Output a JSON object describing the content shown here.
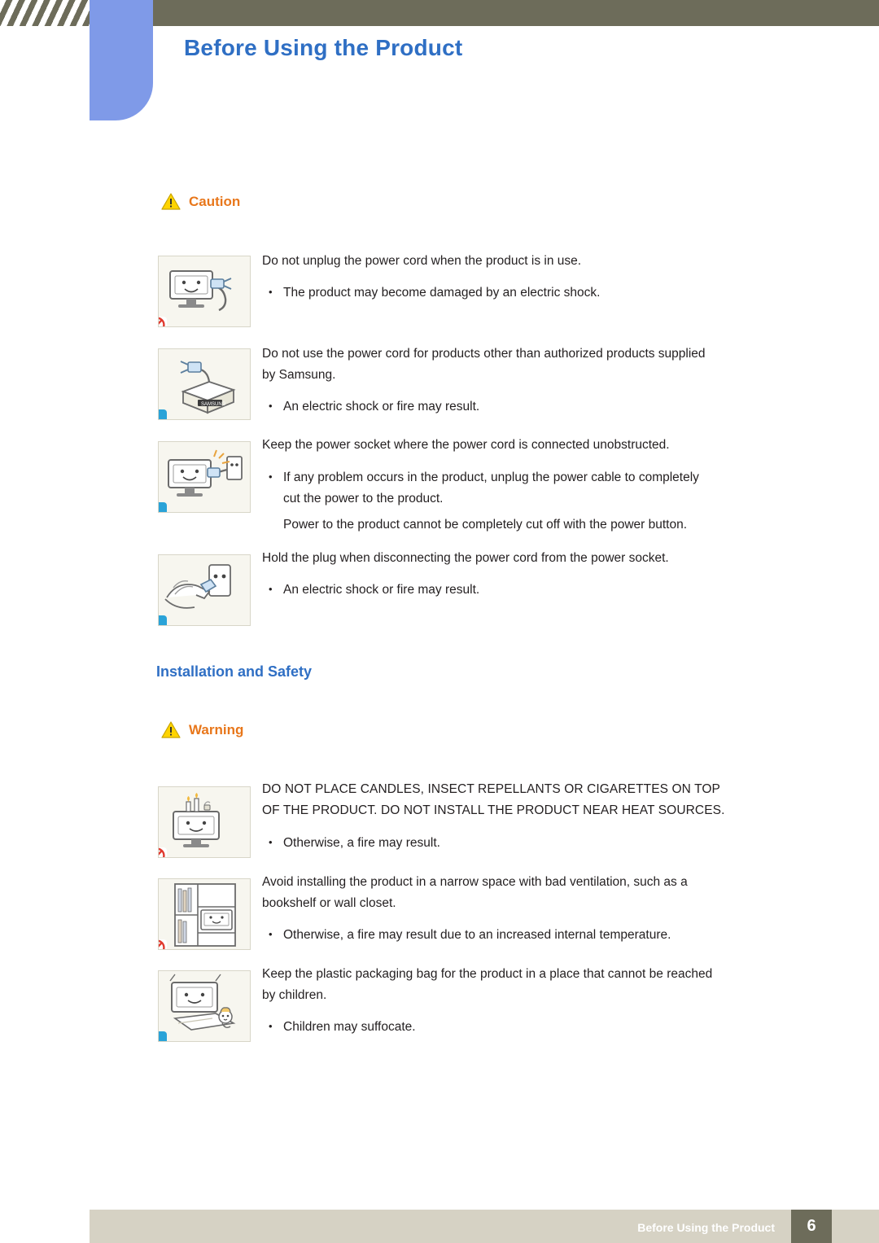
{
  "header": {
    "title": "Before Using the Product"
  },
  "caution": {
    "label": "Caution",
    "icon": "warning-triangle-icon",
    "items": [
      {
        "figure": "monitor-unplug-icon",
        "badge": "forbid",
        "lines": [
          "Do not unplug the power cord when the product is in use."
        ],
        "bullets": [
          "The product may become damaged by an electric shock."
        ]
      },
      {
        "figure": "power-cord-box-icon",
        "badge": "info",
        "lines": [
          "Do not use the power cord for products other than authorized products supplied",
          "by Samsung."
        ],
        "bullets": [
          "An electric shock or fire may result."
        ]
      },
      {
        "figure": "monitor-socket-icon",
        "badge": "info",
        "lines": [
          "Keep the power socket where the power cord is connected unobstructed."
        ],
        "bullets": [
          "If any problem occurs in the product, unplug the power cable to completely",
          "cut the power to the product."
        ],
        "extra": [
          "Power to the product cannot be completely cut off with the power button."
        ]
      },
      {
        "figure": "hand-plug-socket-icon",
        "badge": "info",
        "lines": [
          "Hold the plug when disconnecting the power cord from the power socket."
        ],
        "bullets": [
          "An electric shock or fire may result."
        ]
      }
    ]
  },
  "section": {
    "title": "Installation and Safety"
  },
  "warning": {
    "label": "Warning",
    "icon": "warning-triangle-icon",
    "items": [
      {
        "figure": "candles-on-monitor-icon",
        "badge": "forbid",
        "lines": [
          "DO NOT PLACE CANDLES, INSECT REPELLANTS OR CIGARETTES ON TOP",
          "OF THE PRODUCT. DO NOT INSTALL THE PRODUCT NEAR HEAT SOURCES."
        ],
        "bullets": [
          "Otherwise, a fire may result."
        ]
      },
      {
        "figure": "bookshelf-monitor-icon",
        "badge": "forbid",
        "lines": [
          "Avoid installing the product in a narrow space with bad ventilation, such as a",
          "bookshelf or wall closet."
        ],
        "bullets": [
          "Otherwise, a fire may result due to an increased internal temperature."
        ]
      },
      {
        "figure": "plastic-bag-child-icon",
        "badge": "info",
        "lines": [
          "Keep the plastic packaging bag for the product in a place that cannot be reached",
          "by children."
        ],
        "bullets": [
          "Children may suffocate."
        ]
      }
    ]
  },
  "footer": {
    "text": "Before Using the Product",
    "page": "6"
  },
  "colors": {
    "title_blue": "#2f6fc4",
    "notice_orange": "#e8771b",
    "band_olive": "#6d6c5a",
    "tab_blue": "#7f9ae8",
    "footer_band": "#d6d2c4",
    "figure_bg": "#f7f6ef"
  }
}
